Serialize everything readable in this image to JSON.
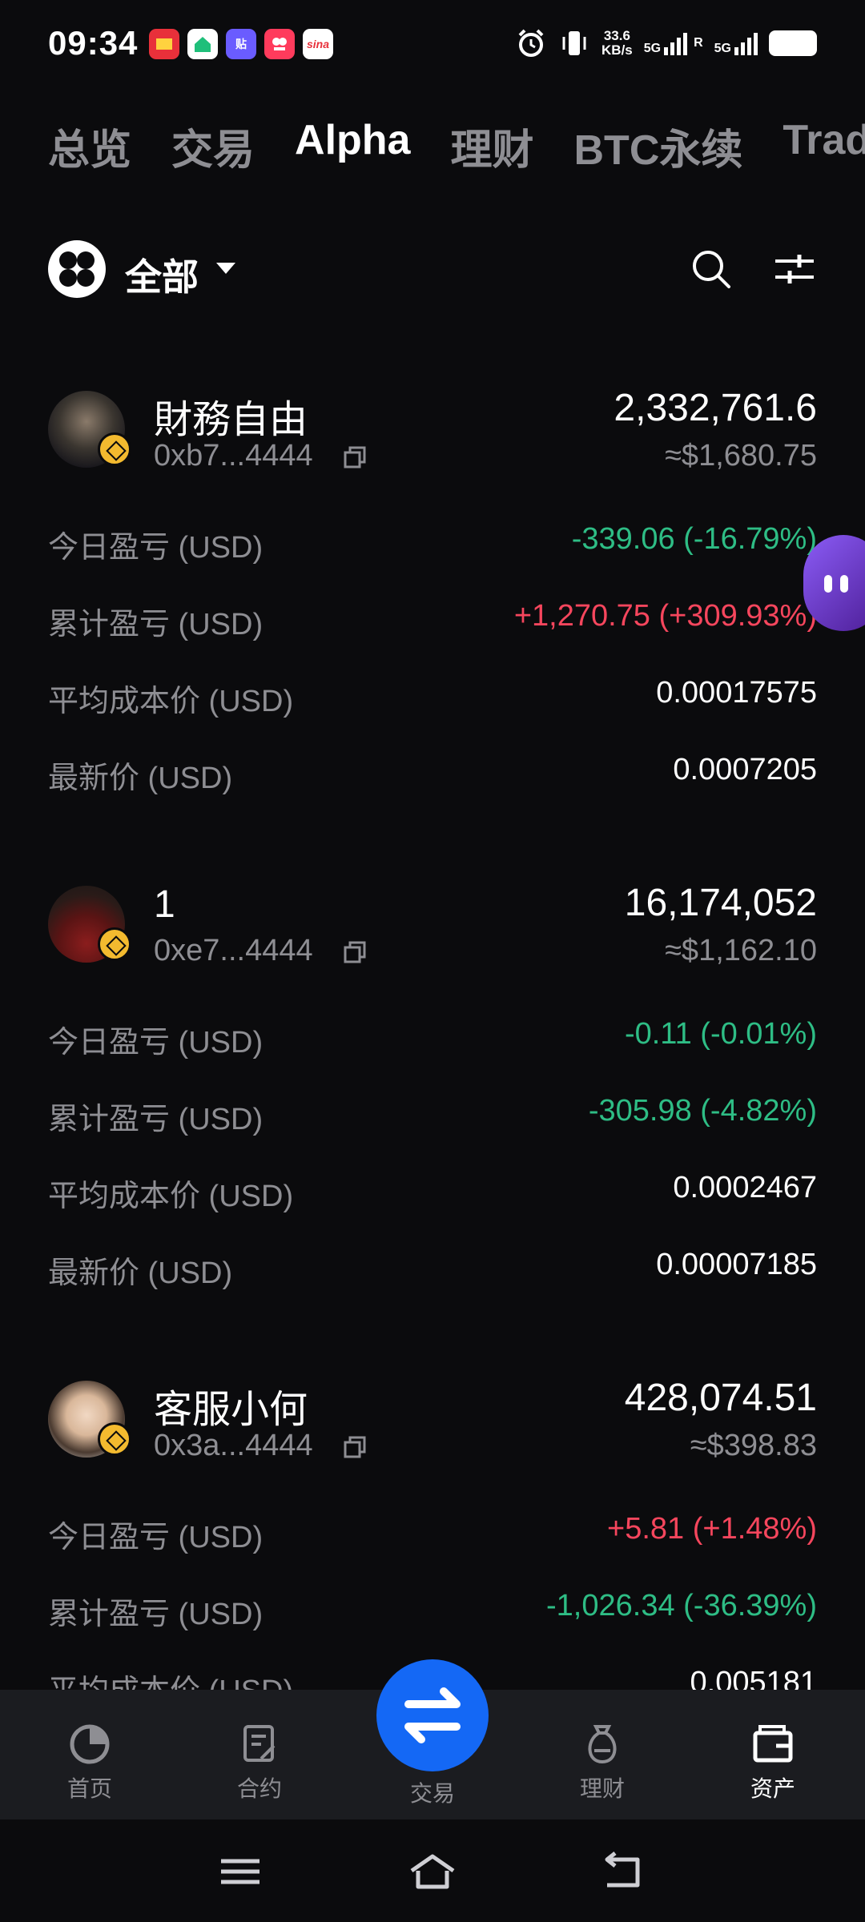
{
  "status_bar": {
    "time": "09:34",
    "net_speed": "33.6",
    "net_speed_unit": "KB/s",
    "network1": "5G",
    "network2": "5G",
    "roaming": "R",
    "apps": [
      {
        "name": "news-app-icon",
        "color": "#e8303a"
      },
      {
        "name": "home-app-icon",
        "color": "#1fbf7a"
      },
      {
        "name": "tieba-app-icon",
        "color": "#6a5cff",
        "text": "贴"
      },
      {
        "name": "photo-app-icon",
        "color": "#ff3b5c"
      },
      {
        "name": "sina-app-icon",
        "color": "#ffffff",
        "text": "sina"
      }
    ]
  },
  "top_tabs": [
    {
      "label": "总览",
      "active": false
    },
    {
      "label": "交易",
      "active": false
    },
    {
      "label": "Alpha",
      "active": true
    },
    {
      "label": "理财",
      "active": false
    },
    {
      "label": "BTC永续",
      "active": false
    },
    {
      "label": "Trad",
      "active": false
    }
  ],
  "filter": {
    "label": "全部"
  },
  "holdings": [
    {
      "name": "財務自由",
      "address": "0xb7...4444",
      "amount": "2,332,761.6",
      "usd_value": "≈$1,680.75",
      "today_pnl_label": "今日盈亏 (USD)",
      "today_pnl": "-339.06 (-16.79%)",
      "total_pnl_label": "累计盈亏 (USD)",
      "total_pnl": "+1,270.75 (+309.93%)",
      "avg_cost_label": "平均成本价 (USD)",
      "avg_cost": "0.00017575",
      "last_price_label": "最新价 (USD)",
      "last_price": "0.0007205"
    },
    {
      "name": "1",
      "address": "0xe7...4444",
      "amount": "16,174,052",
      "usd_value": "≈$1,162.10",
      "today_pnl_label": "今日盈亏 (USD)",
      "today_pnl": "-0.11 (-0.01%)",
      "total_pnl_label": "累计盈亏 (USD)",
      "total_pnl": "-305.98 (-4.82%)",
      "avg_cost_label": "平均成本价 (USD)",
      "avg_cost": "0.0002467",
      "last_price_label": "最新价 (USD)",
      "last_price": "0.00007185"
    },
    {
      "name": "客服小何",
      "address": "0x3a...4444",
      "amount": "428,074.51",
      "usd_value": "≈$398.83",
      "today_pnl_label": "今日盈亏 (USD)",
      "today_pnl": "+5.81 (+1.48%)",
      "total_pnl_label": "累计盈亏 (USD)",
      "total_pnl": "-1,026.34 (-36.39%)",
      "avg_cost_label": "平均成本价 (USD)",
      "avg_cost": "0.005181"
    }
  ],
  "bottom_nav": [
    {
      "label": "首页",
      "icon": "home-icon"
    },
    {
      "label": "合约",
      "icon": "contract-icon"
    },
    {
      "label": "交易",
      "icon": "swap-icon"
    },
    {
      "label": "理财",
      "icon": "earn-icon"
    },
    {
      "label": "资产",
      "icon": "wallet-icon",
      "active": true
    }
  ],
  "colors": {
    "background": "#0b0b0d",
    "positive": "#f6465d",
    "negative": "#2ebd85",
    "muted": "#8e8e93",
    "accent": "#1468f5",
    "nav_bg": "#1b1c20"
  }
}
